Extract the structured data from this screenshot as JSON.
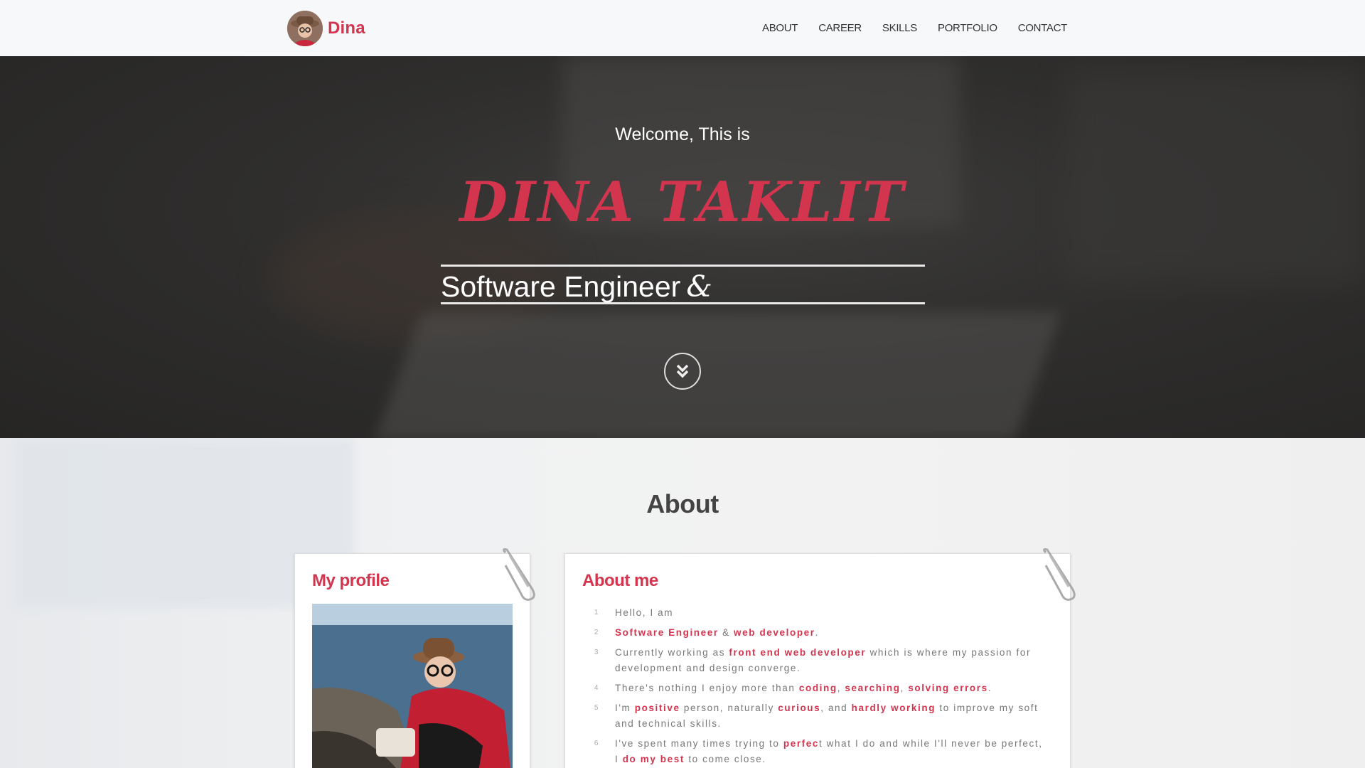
{
  "navbar": {
    "brand_name": "Dina",
    "items": [
      "ABOUT",
      "CAREER",
      "SKILLS",
      "PORTFOLIO",
      "CONTACT"
    ]
  },
  "hero": {
    "welcome": "Welcome, This is",
    "name": "DINA TAKLIT",
    "role": "Software Engineer",
    "role_suffix": "&",
    "scroll_icon": "chevron-double-down-icon"
  },
  "about": {
    "title": "About",
    "profile_title": "My profile",
    "about_title": "About me",
    "lines": [
      {
        "n": "1",
        "parts": [
          {
            "t": "Hello, I am",
            "h": false
          }
        ]
      },
      {
        "n": "2",
        "parts": [
          {
            "t": "Software Engineer",
            "h": true
          },
          {
            "t": " & ",
            "h": false
          },
          {
            "t": "web developer",
            "h": true
          },
          {
            "t": ".",
            "h": false
          }
        ]
      },
      {
        "n": "3",
        "parts": [
          {
            "t": "Currently working as ",
            "h": false
          },
          {
            "t": "front end web developer",
            "h": true
          },
          {
            "t": " which is where my passion for development and design converge.",
            "h": false
          }
        ]
      },
      {
        "n": "4",
        "parts": [
          {
            "t": "There's nothing I enjoy more than ",
            "h": false
          },
          {
            "t": "coding",
            "h": true
          },
          {
            "t": ", ",
            "h": false
          },
          {
            "t": "searching",
            "h": true
          },
          {
            "t": ", ",
            "h": false
          },
          {
            "t": "solving errors",
            "h": true
          },
          {
            "t": ".",
            "h": false
          }
        ]
      },
      {
        "n": "5",
        "parts": [
          {
            "t": "I'm ",
            "h": false
          },
          {
            "t": "positive",
            "h": true
          },
          {
            "t": " person, naturally ",
            "h": false
          },
          {
            "t": "curious",
            "h": true
          },
          {
            "t": ", and ",
            "h": false
          },
          {
            "t": "hardly working",
            "h": true
          },
          {
            "t": " to improve my soft and technical skills.",
            "h": false
          }
        ]
      },
      {
        "n": "6",
        "parts": [
          {
            "t": "I've spent many times trying to ",
            "h": false
          },
          {
            "t": "perfec",
            "h": true
          },
          {
            "t": "t what I do and while I'll never be perfect, I ",
            "h": false
          },
          {
            "t": "do my best",
            "h": true
          },
          {
            "t": " to come close.",
            "h": false
          }
        ]
      }
    ]
  },
  "colors": {
    "accent": "#d3344e",
    "navbar_bg": "#f7f8f9",
    "hero_bg": "#2f2e2d"
  }
}
